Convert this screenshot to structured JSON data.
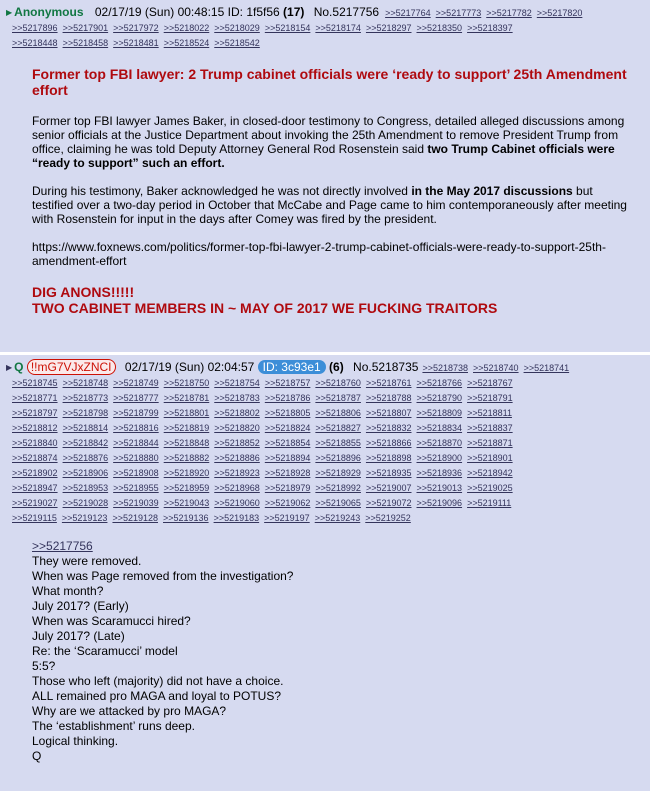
{
  "post1": {
    "name": "Anonymous",
    "date": "02/17/19 (Sun) 00:48:15",
    "id_label": "ID:",
    "id_value": "1f5f56",
    "reply_count": "(17)",
    "post_no": "No.5217756",
    "backlink_rows": [
      [
        ">>5217764",
        ">>5217773",
        ">>5217782",
        ">>5217820"
      ],
      [
        ">>5217896",
        ">>5217901",
        ">>5217972",
        ">>5218022",
        ">>5218029",
        ">>5218154",
        ">>5218174",
        ">>5218297",
        ">>5218350",
        ">>5218397"
      ],
      [
        ">>5218448",
        ">>5218458",
        ">>5218481",
        ">>5218524",
        ">>5218542"
      ]
    ],
    "headline": "Former top FBI lawyer: 2 Trump cabinet officials were ‘ready to support’ 25th Amendment effort",
    "para1_a": "Former top FBI lawyer James Baker, in closed-door testimony to Congress, detailed alleged discussions among senior officials at the Justice Department about invoking the 25th Amendment to remove President Trump from office, claiming he was told Deputy Attorney General Rod Rosenstein said ",
    "para1_bold": "two Trump Cabinet officials were “ready to support” such an effort.",
    "para2_a": "During his testimony, Baker acknowledged he was not directly involved ",
    "para2_bold": "in the May 2017 discussions",
    "para2_b": " but testified over a two-day period in October that McCabe and Page came to him contemporaneously after meeting with Rosenstein for input in the days after Comey was fired by the president.",
    "url": "https://www.foxnews.com/politics/former-top-fbi-lawyer-2-trump-cabinet-officials-were-ready-to-support-25th-amendment-effort",
    "red_line1": "DIG ANONS!!!!!",
    "red_line2": "TWO CABINET MEMBERS IN ~ MAY OF 2017 WE FUCKING TRAITORS"
  },
  "post2": {
    "name": "Q",
    "trip": "!!mG7VJxZNCI",
    "date": "02/17/19 (Sun) 02:04:57",
    "id_badge": "ID: 3c93e1",
    "reply_count": "(6)",
    "post_no": "No.5218735",
    "backlink_rows": [
      [
        ">>5218738",
        ">>5218740",
        ">>5218741"
      ],
      [
        ">>5218745",
        ">>5218748",
        ">>5218749",
        ">>5218750",
        ">>5218754",
        ">>5218757",
        ">>5218760",
        ">>5218761",
        ">>5218766",
        ">>5218767"
      ],
      [
        ">>5218771",
        ">>5218773",
        ">>5218777",
        ">>5218781",
        ">>5218783",
        ">>5218786",
        ">>5218787",
        ">>5218788",
        ">>5218790",
        ">>5218791"
      ],
      [
        ">>5218797",
        ">>5218798",
        ">>5218799",
        ">>5218801",
        ">>5218802",
        ">>5218805",
        ">>5218806",
        ">>5218807",
        ">>5218809",
        ">>5218811"
      ],
      [
        ">>5218812",
        ">>5218814",
        ">>5218816",
        ">>5218819",
        ">>5218820",
        ">>5218824",
        ">>5218827",
        ">>5218832",
        ">>5218834",
        ">>5218837"
      ],
      [
        ">>5218840",
        ">>5218842",
        ">>5218844",
        ">>5218848",
        ">>5218852",
        ">>5218854",
        ">>5218855",
        ">>5218866",
        ">>5218870",
        ">>5218871"
      ],
      [
        ">>5218874",
        ">>5218876",
        ">>5218880",
        ">>5218882",
        ">>5218886",
        ">>5218894",
        ">>5218896",
        ">>5218898",
        ">>5218900",
        ">>5218901"
      ],
      [
        ">>5218902",
        ">>5218906",
        ">>5218908",
        ">>5218920",
        ">>5218923",
        ">>5218928",
        ">>5218929",
        ">>5218935",
        ">>5218936",
        ">>5218942"
      ],
      [
        ">>5218947",
        ">>5218953",
        ">>5218955",
        ">>5218959",
        ">>5218968",
        ">>5218979",
        ">>5218992",
        ">>5219007",
        ">>5219013",
        ">>5219025"
      ],
      [
        ">>5219027",
        ">>5219028",
        ">>5219039",
        ">>5219043",
        ">>5219060",
        ">>5219062",
        ">>5219065",
        ">>5219072",
        ">>5219096",
        ">>5219111"
      ],
      [
        ">>5219115",
        ">>5219123",
        ">>5219128",
        ">>5219136",
        ">>5219183",
        ">>5219197",
        ">>5219243",
        ">>5219252"
      ]
    ],
    "quote_link": ">>5217756",
    "lines": [
      "They were removed.",
      "When was Page removed from the investigation?",
      "What month?",
      "July 2017? (Early)",
      "When was Scaramucci hired?",
      "July 2017? (Late)",
      "Re: the ‘Scaramucci’ model",
      "5:5?",
      "Those who left (majority) did not have a choice.",
      "ALL remained pro MAGA and loyal to POTUS?",
      "Why are we attacked by pro MAGA?",
      "The ‘establishment’ runs deep.",
      "Logical thinking.",
      "Q"
    ]
  }
}
